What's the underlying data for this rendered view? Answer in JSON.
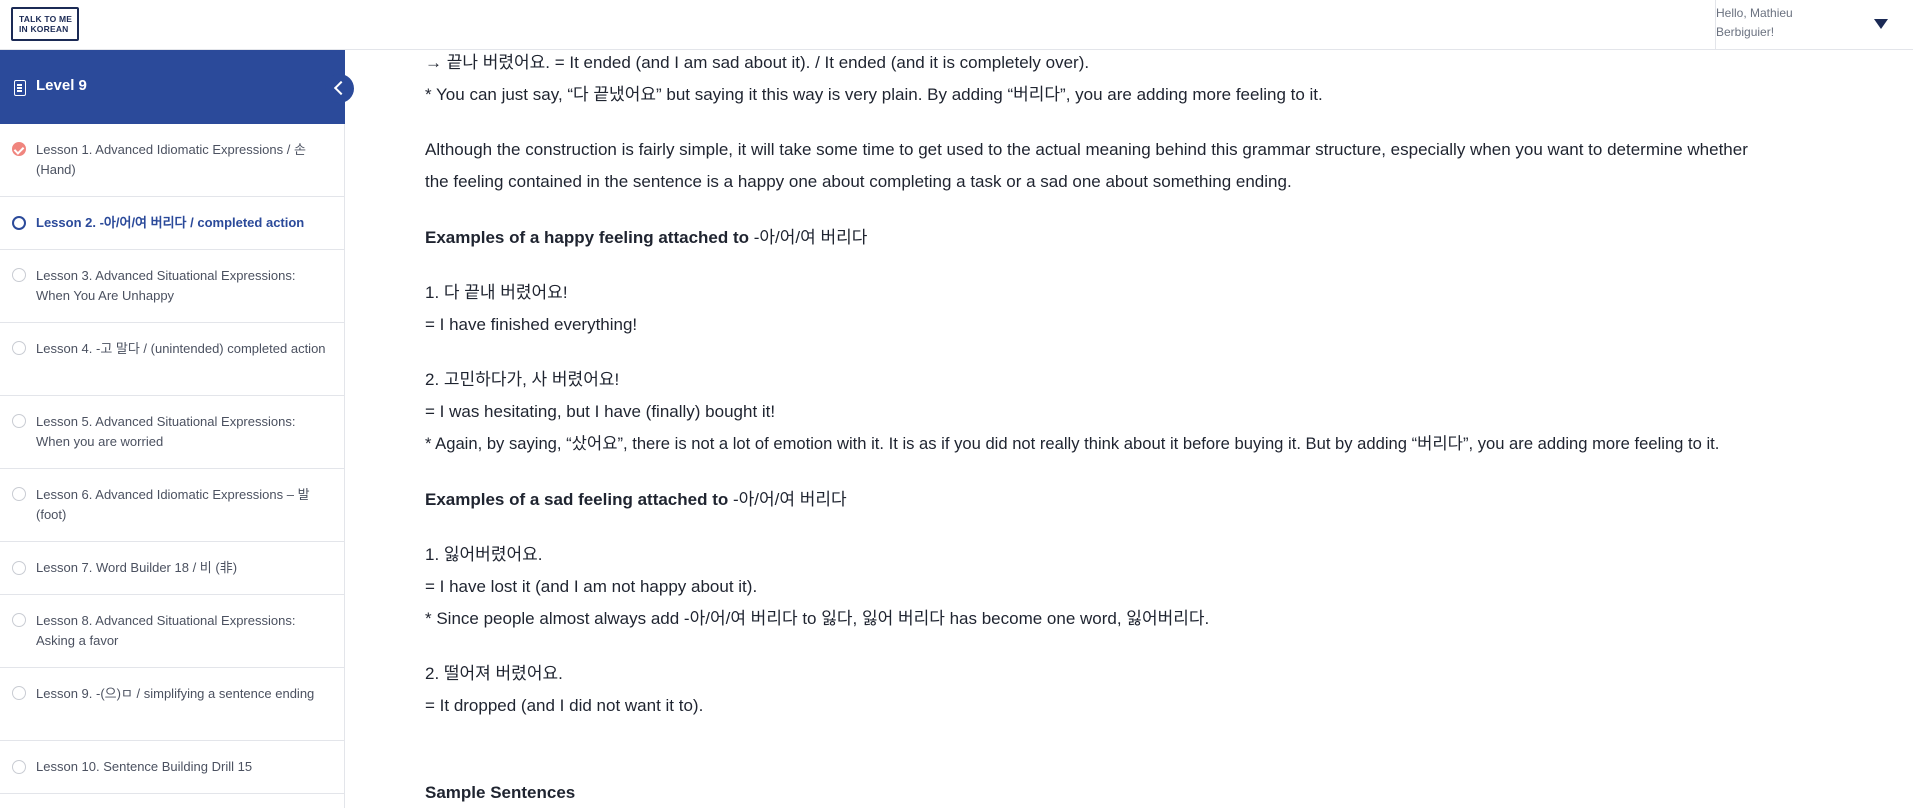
{
  "header": {
    "logo_line1": "TALK TO ME",
    "logo_line2": "IN KOREAN",
    "greeting_line1": "Hello, Mathieu",
    "greeting_line2": "Berbiguier!"
  },
  "sidebar": {
    "level_title": "Level 9",
    "lessons": [
      {
        "label": "Lesson 1. Advanced Idiomatic Expressions / 손 (Hand)",
        "status": "completed"
      },
      {
        "label": "Lesson 2. -아/어/여 버리다 / completed action",
        "status": "current"
      },
      {
        "label": "Lesson 3. Advanced Situational Expressions: When You Are Unhappy",
        "status": "not-started"
      },
      {
        "label": "Lesson 4. -고 말다 / (unintended) completed action",
        "status": "not-started"
      },
      {
        "label": "Lesson 5. Advanced Situational Expressions: When you are worried",
        "status": "not-started"
      },
      {
        "label": "Lesson 6. Advanced Idiomatic Expressions – 발 (foot)",
        "status": "not-started"
      },
      {
        "label": "Lesson 7. Word Builder 18 / 비 (非)",
        "status": "not-started"
      },
      {
        "label": "Lesson 8. Advanced Situational Expressions: Asking a favor",
        "status": "not-started"
      },
      {
        "label": "Lesson 9. -(으)ㅁ / simplifying a sentence ending",
        "status": "not-started"
      },
      {
        "label": "Lesson 10. Sentence Building Drill 15",
        "status": "not-started"
      }
    ]
  },
  "content": {
    "line_ended": "→ 끝나 버렸어요. = It ended (and I am sad about it). / It ended (and it is completely over).",
    "note_plain": "* You can just say, “다 끝냈어요” but saying it this way is very plain. By adding “버리다”, you are adding more feeling to it.",
    "para_line1": "Although the construction is fairly simple, it will take some time to get used to the actual meaning behind this grammar structure, especially when you want to determine whether",
    "para_line2": "the feeling contained in the sentence is a happy one about completing a task or a sad one about something ending.",
    "happy_heading": "Examples of a happy feeling attached to",
    "happy_heading_ko": " -아/어/여 버리다",
    "happy_ex1_ko": "1. 다 끝내 버렸어요!",
    "happy_ex1_en": "= I have finished everything!",
    "happy_ex2_ko": "2. 고민하다가, 사 버렸어요!",
    "happy_ex2_en": "= I was hesitating, but I have (finally) bought it!",
    "happy_ex2_note": "* Again, by saying, “샀어요”, there is not a lot of emotion with it. It is as if you did not really think about it before buying it. But by adding “버리다”, you are adding more feeling to it.",
    "sad_heading": "Examples of a sad feeling attached to",
    "sad_heading_ko": " -아/어/여 버리다",
    "sad_ex1_ko": "1. 잃어버렸어요.",
    "sad_ex1_en": "= I have lost it (and I am not happy about it).",
    "sad_ex1_note": "* Since people almost always add -아/어/여 버리다 to 잃다, 잃어 버리다 has become one word, 잃어버리다.",
    "sad_ex2_ko": "2. 떨어져 버렸어요.",
    "sad_ex2_en": "= It dropped (and I did not want it to).",
    "sample_heading": "Sample Sentences"
  }
}
